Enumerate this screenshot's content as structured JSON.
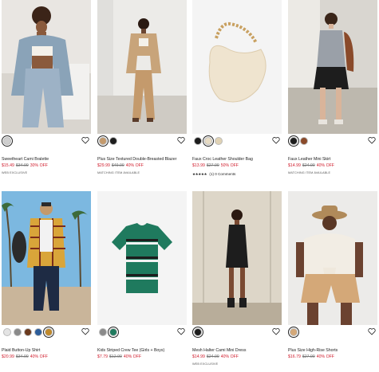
{
  "products": [
    {
      "name": "Sweetheart Cami Bralette",
      "sale": "$15.49",
      "original": "$34.99",
      "discount": "30% OFF",
      "tag": "WEB EXCLUSIVE",
      "swatches": [
        "#cfcfcf"
      ],
      "selected": 0
    },
    {
      "name": "Plus Size Textured Double-Breasted Blazer",
      "sale": "$29.99",
      "original": "$49.99",
      "discount": "40% OFF",
      "tag": "MATCHING ITEM AVAILABLE",
      "swatches": [
        "#c49a6c",
        "#1d1d1d"
      ],
      "selected": 0
    },
    {
      "name": "Faux Croc Leather Shoulder Bag",
      "sale": "$13.99",
      "original": "$27.99",
      "discount": "50% OFF",
      "rating": "★★★★★",
      "reviews": "(1)",
      "comments": "0 Comments",
      "swatches": [
        "#1d1d1d",
        "#e8dcc4",
        "#e0d2b4"
      ],
      "selected": 1
    },
    {
      "name": "Faux Leather Mini Skirt",
      "sale": "$14.99",
      "original": "$24.99",
      "discount": "40% OFF",
      "tag": "MATCHING ITEM AVAILABLE",
      "swatches": [
        "#1d1d1d",
        "#8a4a2a"
      ],
      "selected": 0
    },
    {
      "name": "Plaid Button-Up Shirt",
      "sale": "$20.99",
      "original": "$34.99",
      "discount": "40% OFF",
      "swatches": [
        "#e4e4e4",
        "#8a8a8a",
        "#6b3a1e",
        "#2d5d9a",
        "#c0892a"
      ],
      "selected": 4
    },
    {
      "name": "Kids Striped Crew Tee (Girls + Boys)",
      "sale": "$7.79",
      "original": "$12.99",
      "discount": "40% OFF",
      "swatches": [
        "#8a8a8a",
        "#1f7a5e"
      ],
      "selected": 1
    },
    {
      "name": "Mesh Halter Cami Mini Dress",
      "sale": "$14.99",
      "original": "$24.99",
      "discount": "40% OFF",
      "tag": "WEB EXCLUSIVE",
      "swatches": [
        "#1d1d1d"
      ],
      "selected": 0
    },
    {
      "name": "Plus Size High-Rise Shorts",
      "sale": "$16.79",
      "original": "$27.99",
      "discount": "40% OFF",
      "swatches": [
        "#d4a878"
      ],
      "selected": 0
    }
  ]
}
